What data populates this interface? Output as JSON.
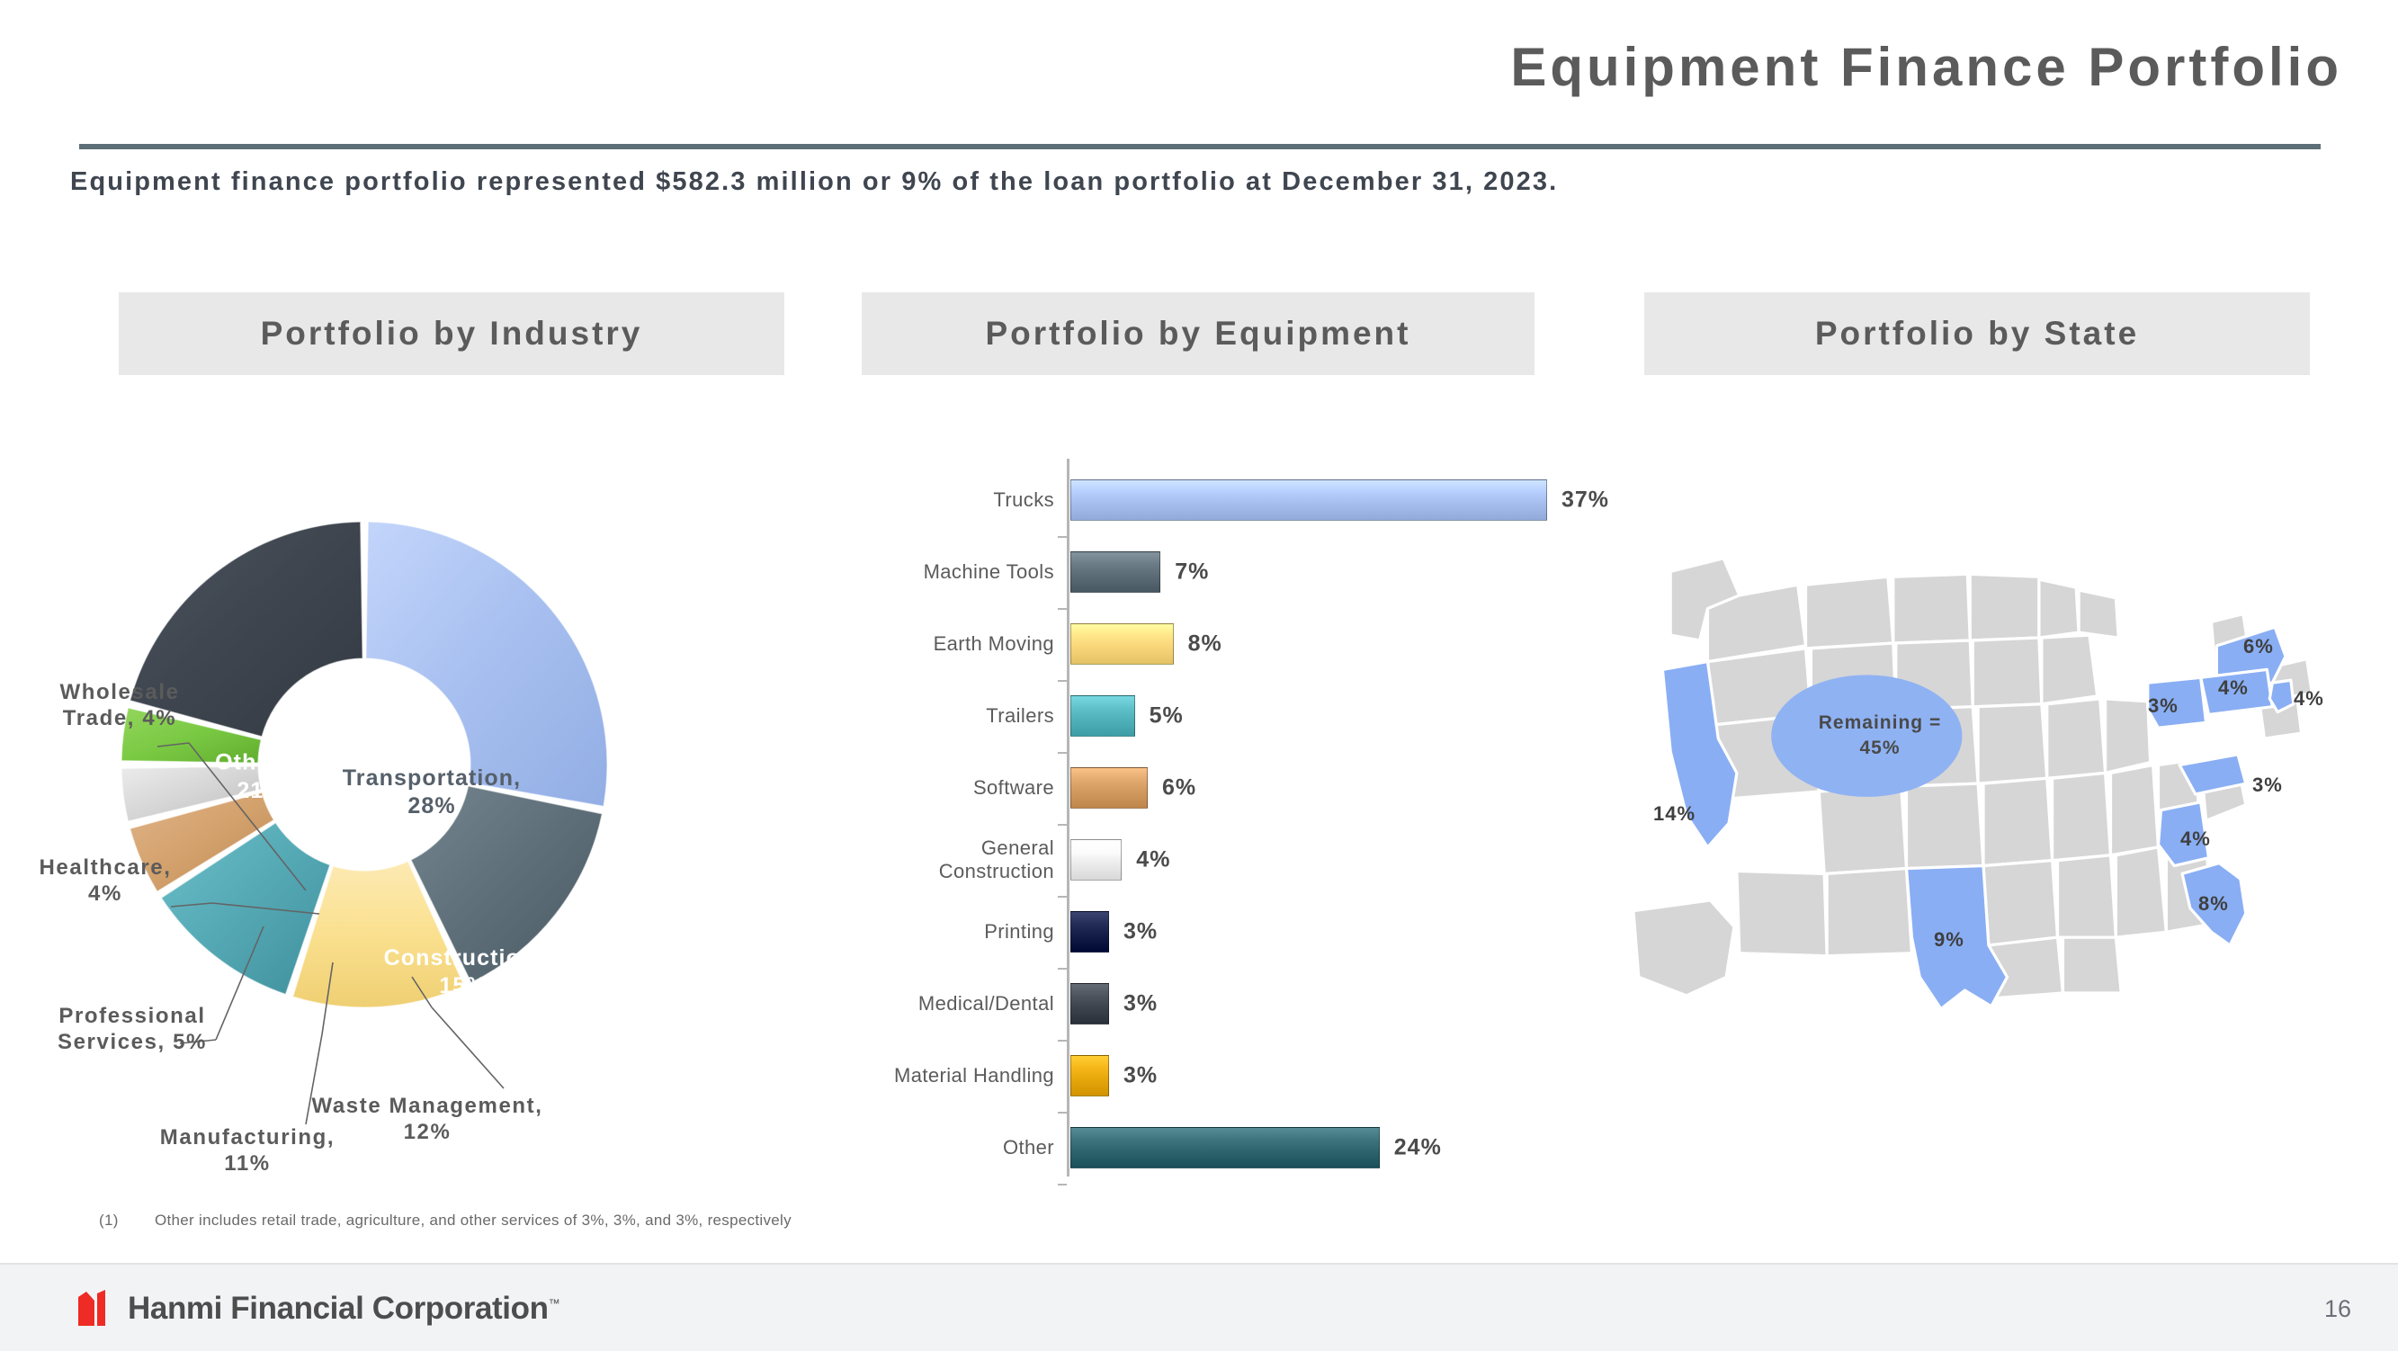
{
  "header": {
    "title": "Equipment Finance Portfolio",
    "subtitle": "Equipment finance portfolio represented $582.3 million or 9% of the loan portfolio at December 31, 2023."
  },
  "panels": {
    "industry_title": "Portfolio by Industry",
    "equipment_title": "Portfolio by Equipment",
    "state_title": "Portfolio by State"
  },
  "footnote": {
    "marker": "(1)",
    "text": "Other includes retail trade, agriculture, and other services of 3%, 3%, and 3%, respectively"
  },
  "footer": {
    "company": "Hanmi Financial Corporation",
    "tm": "™",
    "page": "16"
  },
  "donut_labels": {
    "transportation": "Transportation,\n28%",
    "transportation_l1": "Transportation,",
    "transportation_l2": "28%",
    "construction_l1": "Construction,",
    "construction_l2": "15%",
    "other_l1": "Other,",
    "other_sup": "(1)",
    "other_l2": "21%",
    "wholesale_l1": "Wholesale",
    "wholesale_l2": "Trade, 4%",
    "healthcare_l1": "Healthcare,",
    "healthcare_l2": "4%",
    "professional_l1": "Professional",
    "professional_l2": "Services, 5%",
    "manufacturing_l1": "Manufacturing,",
    "manufacturing_l2": "11%",
    "waste_l1": "Waste Management,",
    "waste_l2": "12%"
  },
  "map_labels": {
    "california": "14%",
    "texas": "9%",
    "newyork": "6%",
    "pennsylvania": "4%",
    "newjersey": "4%",
    "ohio": "3%",
    "northcarolina": "3%",
    "georgia": "4%",
    "florida": "8%",
    "remaining_l1": "Remaining =",
    "remaining_l2": "45%"
  },
  "chart_data": [
    {
      "type": "pie",
      "title": "Portfolio by Industry",
      "units": "percent",
      "donut": true,
      "categories": [
        "Transportation",
        "Construction",
        "Waste Management",
        "Manufacturing",
        "Professional Services",
        "Healthcare",
        "Wholesale Trade",
        "Other"
      ],
      "values": [
        28,
        15,
        12,
        11,
        5,
        4,
        4,
        21
      ],
      "colors": [
        "#a8c0f0",
        "#5d6e78",
        "#fae08f",
        "#54a8b4",
        "#d3a16c",
        "#d3d3d3",
        "#7ac943",
        "#3f4650"
      ],
      "label_style": [
        "inside",
        "inside",
        "leader",
        "leader",
        "leader",
        "leader",
        "leader",
        "inside"
      ],
      "start_angle_deg": 0,
      "direction": "clockwise",
      "footnote_on": "Other"
    },
    {
      "type": "bar",
      "orientation": "horizontal",
      "title": "Portfolio by Equipment",
      "units": "percent",
      "categories": [
        "Trucks",
        "Machine Tools",
        "Earth Moving",
        "Trailers",
        "Software",
        "General Construction",
        "Printing",
        "Medical/Dental",
        "Material Handling",
        "Other"
      ],
      "values": [
        37,
        7,
        8,
        5,
        6,
        4,
        3,
        3,
        3,
        24
      ],
      "value_labels": [
        "37%",
        "7%",
        "8%",
        "5%",
        "6%",
        "4%",
        "3%",
        "3%",
        "3%",
        "24%"
      ],
      "colors": [
        "#a8c0f0",
        "#5d6e78",
        "#fad77b",
        "#53b3bd",
        "#d59c62",
        "#eeeeee",
        "#151f4a",
        "#3f4650",
        "#e8a90d",
        "#2f6670"
      ],
      "xlim": [
        0,
        37
      ],
      "grid": false,
      "legend": "none"
    },
    {
      "type": "map",
      "title": "Portfolio by State",
      "units": "percent",
      "region": "United States",
      "highlight_color": "#89aef4",
      "base_color": "#d6d6d6",
      "categories": [
        "California",
        "Texas",
        "Florida",
        "New York",
        "Pennsylvania",
        "New Jersey",
        "Georgia",
        "Ohio",
        "North Carolina",
        "Remaining"
      ],
      "values": [
        14,
        9,
        8,
        6,
        4,
        4,
        4,
        3,
        3,
        45
      ]
    }
  ]
}
